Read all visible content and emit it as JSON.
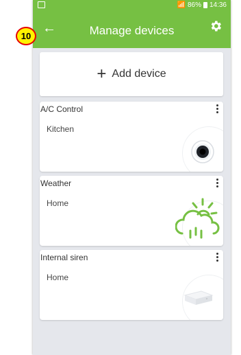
{
  "status": {
    "signal": "📶",
    "battery": "86%",
    "time": "14:36"
  },
  "header": {
    "title": "Manage devices",
    "step_badge": "10"
  },
  "add_device": {
    "label": "Add device"
  },
  "devices": [
    {
      "name": "A/C Control",
      "location": "Kitchen",
      "icon": "ac-control-icon"
    },
    {
      "name": "Weather",
      "location": "Home",
      "icon": "weather-icon"
    },
    {
      "name": "Internal siren",
      "location": "Home",
      "icon": "siren-icon"
    }
  ],
  "colors": {
    "accent": "#76c043",
    "background": "#e5e7ec",
    "badge": "#fff200",
    "badge_border": "#e60000"
  }
}
